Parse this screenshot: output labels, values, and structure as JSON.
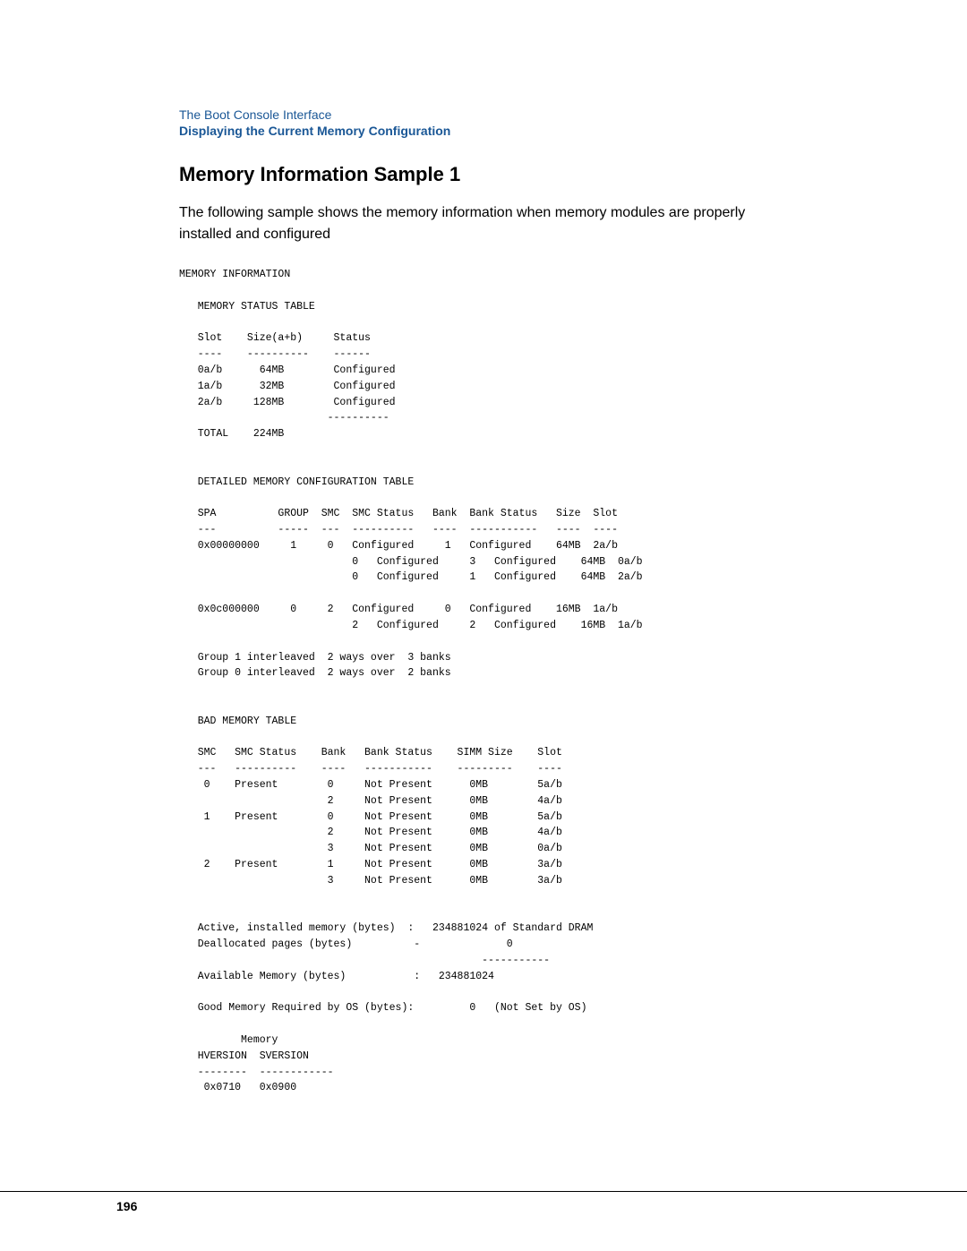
{
  "breadcrumb": {
    "parent_label": "The Boot Console Interface",
    "current_label": "Displaying the Current Memory Configuration"
  },
  "title": "Memory Information Sample 1",
  "intro": "The following sample shows the memory information when memory modules are properly installed and configured",
  "code": "MEMORY INFORMATION\n\n   MEMORY STATUS TABLE\n\n   Slot    Size(a+b)     Status\n   ----    ----------    ------\n   0a/b      64MB        Configured\n   1a/b      32MB        Configured\n   2a/b     128MB        Configured\n                        ----------\n   TOTAL    224MB\n\n\n   DETAILED MEMORY CONFIGURATION TABLE\n\n   SPA          GROUP  SMC  SMC Status   Bank  Bank Status   Size  Slot\n   ---          -----  ---  ----------   ----  -----------   ----  ----\n   0x00000000     1     0   Configured     1   Configured    64MB  2a/b\n                            0   Configured     3   Configured    64MB  0a/b\n                            0   Configured     1   Configured    64MB  2a/b\n\n   0x0c000000     0     2   Configured     0   Configured    16MB  1a/b\n                            2   Configured     2   Configured    16MB  1a/b\n\n   Group 1 interleaved  2 ways over  3 banks\n   Group 0 interleaved  2 ways over  2 banks\n\n\n   BAD MEMORY TABLE\n\n   SMC   SMC Status    Bank   Bank Status    SIMM Size    Slot\n   ---   ----------    ----   -----------    ---------    ----\n    0    Present        0     Not Present      0MB        5a/b\n                        2     Not Present      0MB        4a/b\n    1    Present        0     Not Present      0MB        5a/b\n                        2     Not Present      0MB        4a/b\n                        3     Not Present      0MB        0a/b\n    2    Present        1     Not Present      0MB        3a/b\n                        3     Not Present      0MB        3a/b\n\n\n   Active, installed memory (bytes)  :   234881024 of Standard DRAM\n   Deallocated pages (bytes)          -              0\n                                                 -----------\n   Available Memory (bytes)           :   234881024\n\n   Good Memory Required by OS (bytes):         0   (Not Set by OS)\n\n          Memory\n   HVERSION  SVERSION\n   --------  ------------\n    0x0710   0x0900",
  "footer": {
    "page_number": "196"
  }
}
